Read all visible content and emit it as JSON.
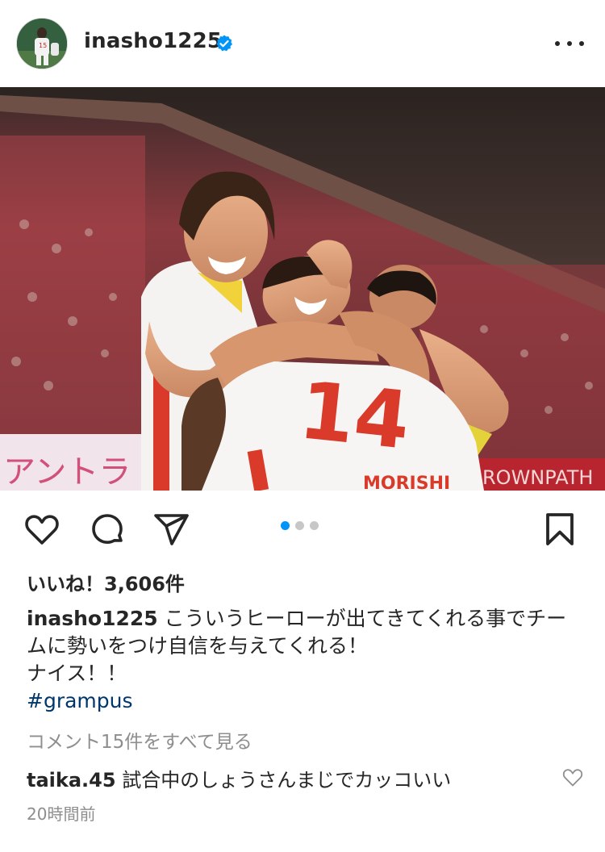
{
  "post": {
    "username": "inasho1225",
    "verified": true,
    "image_alt": "Players celebrating a goal at a stadium",
    "carousel": {
      "total": 3,
      "active_index": 0
    },
    "likes_text": "いいね！3,606件",
    "caption": {
      "username": "inasho1225",
      "line1": "こういうヒーローが出てきてくれる事でチー",
      "line2": "ムに勢いをつけ自信を与えてくれる！",
      "line3": "ナイス！！"
    },
    "hashtag": "#grampus",
    "view_comments": "コメント15件をすべて見る",
    "comment": {
      "username": "taika.45",
      "text": "試合中のしょうさんまじでカッコいい"
    },
    "timestamp": "20時間前"
  },
  "colors": {
    "link": "#00376b",
    "verified": "#0095f6",
    "muted": "#8e8e8e",
    "text": "#262626",
    "active_dot": "#0095f6",
    "inactive_dot": "#c7c7c7"
  },
  "icons": {
    "like": "heart-icon",
    "comment": "comment-bubble-icon",
    "share": "paper-plane-icon",
    "save": "bookmark-icon",
    "more": "more-horizontal-icon",
    "verified": "verified-badge-icon"
  }
}
